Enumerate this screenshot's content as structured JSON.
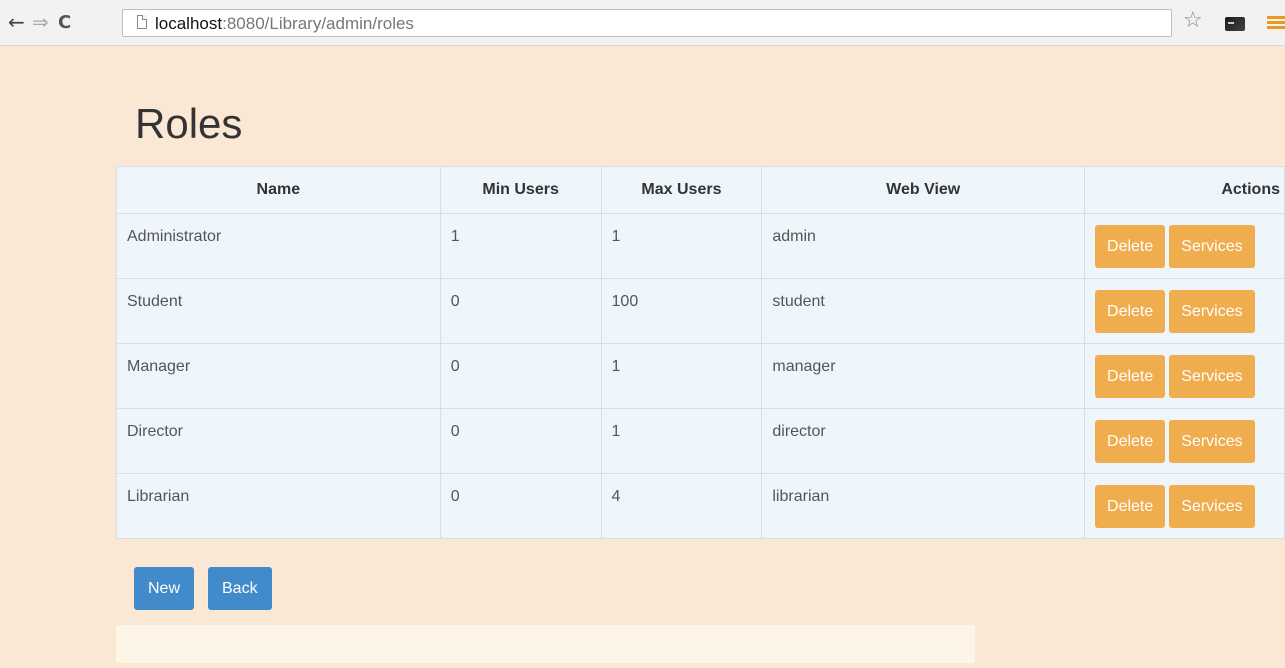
{
  "browser": {
    "url_host": "localhost",
    "url_path": ":8080/Library/admin/roles",
    "back_glyph": "←",
    "forward_glyph": "⇒",
    "reload_glyph": "C",
    "star_glyph": "☆"
  },
  "page": {
    "title": "Roles"
  },
  "table": {
    "headers": {
      "name": "Name",
      "min_users": "Min Users",
      "max_users": "Max Users",
      "web_view": "Web View",
      "actions": "Actions"
    },
    "rows": [
      {
        "name": "Administrator",
        "min_users": "1",
        "max_users": "1",
        "web_view": "admin",
        "delete_label": "Delete",
        "services_label": "Services"
      },
      {
        "name": "Student",
        "min_users": "0",
        "max_users": "100",
        "web_view": "student",
        "delete_label": "Delete",
        "services_label": "Services"
      },
      {
        "name": "Manager",
        "min_users": "0",
        "max_users": "1",
        "web_view": "manager",
        "delete_label": "Delete",
        "services_label": "Services"
      },
      {
        "name": "Director",
        "min_users": "0",
        "max_users": "1",
        "web_view": "director",
        "delete_label": "Delete",
        "services_label": "Services"
      },
      {
        "name": "Librarian",
        "min_users": "0",
        "max_users": "4",
        "web_view": "librarian",
        "delete_label": "Delete",
        "services_label": "Services"
      }
    ]
  },
  "buttons": {
    "new_label": "New",
    "back_label": "Back"
  },
  "colors": {
    "page_background": "#fae8d4",
    "table_background": "#eef6fb",
    "warning_button": "#f0ad4e",
    "primary_button": "#428bca"
  }
}
